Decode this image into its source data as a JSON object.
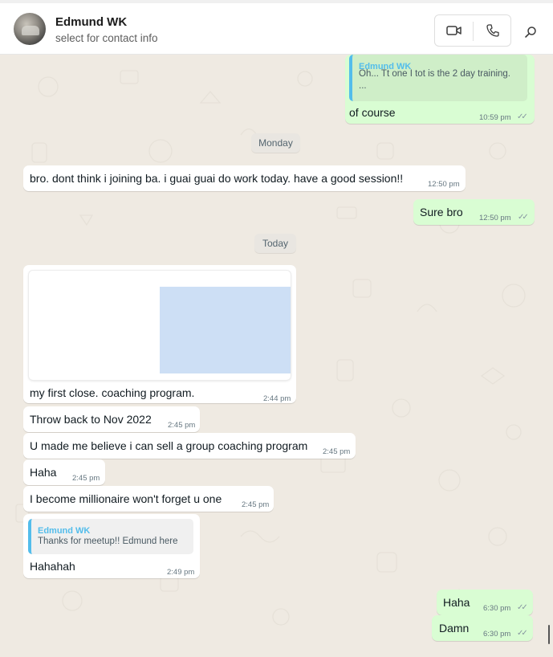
{
  "header": {
    "contact_name": "Edmund WK",
    "contact_subtitle": "select for contact info",
    "icons": {
      "video": "video-camera-icon",
      "voice": "phone-icon",
      "search": "search-icon"
    }
  },
  "colors": {
    "incoming": "#ffffff",
    "outgoing": "#d9fdd3",
    "quote_bar": "#53bdeb",
    "chat_bg": "#efeae2",
    "image_placeholder": "#cddff5"
  },
  "messages": {
    "m1": {
      "quote_name": "Edmund WK",
      "quote_line1": "Oh... Tt one I tot is the 2 day training.",
      "quote_line2": "...",
      "text": "of course",
      "time": "10:59 pm",
      "ticks": "✓✓"
    },
    "date_monday": "Monday",
    "m2": {
      "text": "bro. dont think i joining ba. i guai guai do work today.  have a good session!!",
      "time": "12:50 pm"
    },
    "m3": {
      "text": "Sure bro",
      "time": "12:50 pm",
      "ticks": "✓✓"
    },
    "date_today": "Today",
    "m4": {
      "text": "my first close. coaching program.",
      "time": "2:44 pm"
    },
    "m5": {
      "text": "Throw back to Nov 2022",
      "time": "2:45 pm"
    },
    "m6": {
      "text": "U made me believe i can sell a group coaching program",
      "time": "2:45 pm"
    },
    "m7": {
      "text": "Haha",
      "time": "2:45 pm"
    },
    "m8": {
      "text": "I become millionaire won't forget u one",
      "time": "2:45 pm"
    },
    "m9": {
      "quote_name": "Edmund WK",
      "quote_text": "Thanks for meetup!! Edmund here",
      "text": "Hahahah",
      "time": "2:49 pm"
    },
    "m10": {
      "text": "Haha",
      "time": "6:30 pm",
      "ticks": "✓✓"
    },
    "m11": {
      "text": "Damn",
      "time": "6:30 pm",
      "ticks": "✓✓"
    }
  }
}
